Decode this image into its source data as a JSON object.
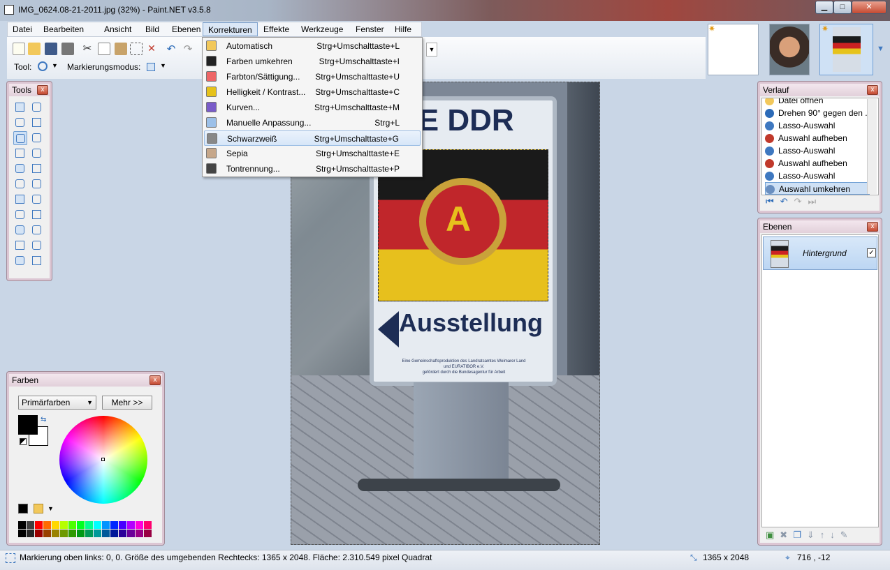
{
  "window": {
    "title": "IMG_0624.08-21-2011.jpg (32%) - Paint.NET v3.5.8",
    "min": "▁",
    "max": "□",
    "close": "✕"
  },
  "menu": [
    "Datei",
    "Bearbeiten",
    "Ansicht",
    "Bild",
    "Ebenen",
    "Korrekturen",
    "Effekte",
    "Werkzeuge",
    "Fenster",
    "Hilfe"
  ],
  "menu_active_index": 5,
  "toolbar": {
    "tool_label": "Tool:",
    "selection_mode_label": "Markierungsmodus:"
  },
  "dropdown": {
    "items": [
      {
        "label": "Automatisch",
        "shortcut": "Strg+Umschalttaste+L",
        "icon": "auto-level-icon"
      },
      {
        "label": "Farben umkehren",
        "shortcut": "Strg+Umschalttaste+I",
        "icon": "invert-colors-icon"
      },
      {
        "label": "Farbton/Sättigung...",
        "shortcut": "Strg+Umschalttaste+U",
        "icon": "hue-saturation-icon"
      },
      {
        "label": "Helligkeit / Kontrast...",
        "shortcut": "Strg+Umschalttaste+C",
        "icon": "brightness-contrast-icon"
      },
      {
        "label": "Kurven...",
        "shortcut": "Strg+Umschalttaste+M",
        "icon": "curves-icon"
      },
      {
        "label": "Manuelle Anpassung...",
        "shortcut": "Strg+L",
        "icon": "levels-icon"
      },
      {
        "label": "Schwarzweiß",
        "shortcut": "Strg+Umschalttaste+G",
        "icon": "black-white-icon"
      },
      {
        "label": "Sepia",
        "shortcut": "Strg+Umschalttaste+E",
        "icon": "sepia-icon"
      },
      {
        "label": "Tontrennung...",
        "shortcut": "Strg+Umschalttaste+P",
        "icon": "posterize-icon"
      }
    ],
    "highlighted_index": 6
  },
  "tools_panel": {
    "title": "Tools",
    "close": "x"
  },
  "colors_panel": {
    "title": "Farben",
    "close": "x",
    "mode_select": "Primärfarben",
    "more_button": "Mehr >>",
    "primary_color": "#000000",
    "secondary_color": "#ffffff"
  },
  "history_panel": {
    "title": "Verlauf",
    "close": "x",
    "items": [
      {
        "label": "Datei öffnen",
        "icon": "open-file-icon"
      },
      {
        "label": "Drehen 90° gegen den ...",
        "icon": "rotate-icon"
      },
      {
        "label": "Lasso-Auswahl",
        "icon": "lasso-icon"
      },
      {
        "label": "Auswahl aufheben",
        "icon": "deselect-icon"
      },
      {
        "label": "Lasso-Auswahl",
        "icon": "lasso-icon"
      },
      {
        "label": "Auswahl aufheben",
        "icon": "deselect-icon"
      },
      {
        "label": "Lasso-Auswahl",
        "icon": "lasso-icon"
      },
      {
        "label": "Auswahl umkehren",
        "icon": "invert-selection-icon"
      }
    ],
    "selected_index": 7
  },
  "layers_panel": {
    "title": "Ebenen",
    "close": "x",
    "layer_name": "Hintergrund",
    "visible_check": "✓"
  },
  "image": {
    "sign_top": "LLE DDR",
    "sign_main": "Ausstellung",
    "sign_small_1": "Eine Gemeinschaftsproduktion des Landratsamtes Weimarer Land",
    "sign_small_2": "und EURATIBOR e.V.",
    "sign_small_3": "gefördert durch die Bundesagentur für Arbeit"
  },
  "status": {
    "message": "Markierung oben links: 0, 0. Größe des umgebenden Rechtecks: 1365 x 2048. Fläche: 2.310.549 pixel Quadrat",
    "size": "1365 x 2048",
    "cursor": "716 , -12"
  },
  "palette": [
    "#000000",
    "#404040",
    "#ff0000",
    "#ff6a00",
    "#ffd800",
    "#b6ff00",
    "#4cff00",
    "#00ff21",
    "#00ff90",
    "#00ffff",
    "#0094ff",
    "#0026ff",
    "#4800ff",
    "#b200ff",
    "#ff00dc",
    "#ff006e"
  ]
}
